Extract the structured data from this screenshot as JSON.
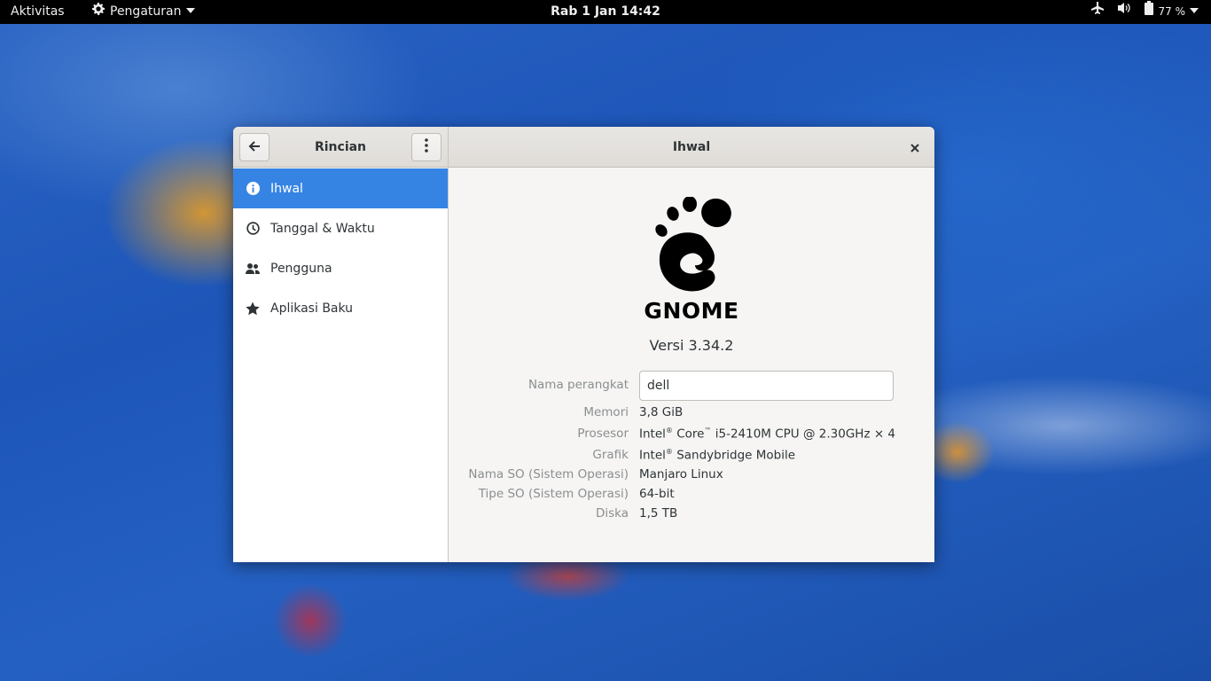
{
  "topbar": {
    "activities": "Aktivitas",
    "app_menu": "Pengaturan",
    "clock": "Rab 1 Jan  14:42",
    "battery": "77 %",
    "icons": [
      "airplane-icon",
      "volume-icon",
      "battery-icon"
    ]
  },
  "window": {
    "left_title": "Rincian",
    "right_title": "Ihwal",
    "sidebar": {
      "items": [
        {
          "label": "Ihwal",
          "icon": "info-icon",
          "active": true
        },
        {
          "label": "Tanggal & Waktu",
          "icon": "clock-icon",
          "active": false
        },
        {
          "label": "Pengguna",
          "icon": "users-icon",
          "active": false
        },
        {
          "label": "Aplikasi Baku",
          "icon": "star-icon",
          "active": false
        }
      ]
    },
    "about": {
      "logo_text": "GNOME",
      "version": "Versi 3.34.2",
      "device_name_label": "Nama perangkat",
      "device_name_value": "dell",
      "memory_label": "Memori",
      "memory_value": "3,8 GiB",
      "processor_label": "Prosesor",
      "processor_brand": "Intel",
      "processor_core": "Core",
      "processor_rest": "i5-2410M CPU @ 2.30GHz × 4",
      "graphics_label": "Grafik",
      "graphics_brand": "Intel",
      "graphics_rest": "Sandybridge Mobile",
      "os_name_label": "Nama SO (Sistem Operasi)",
      "os_name_value": "Manjaro Linux",
      "os_type_label": "Tipe SO (Sistem Operasi)",
      "os_type_value": "64-bit",
      "disk_label": "Diska",
      "disk_value": "1,5 TB"
    }
  },
  "colors": {
    "accent": "#3584e4",
    "topbar": "#000000",
    "label_gray": "#8b8e8f"
  }
}
